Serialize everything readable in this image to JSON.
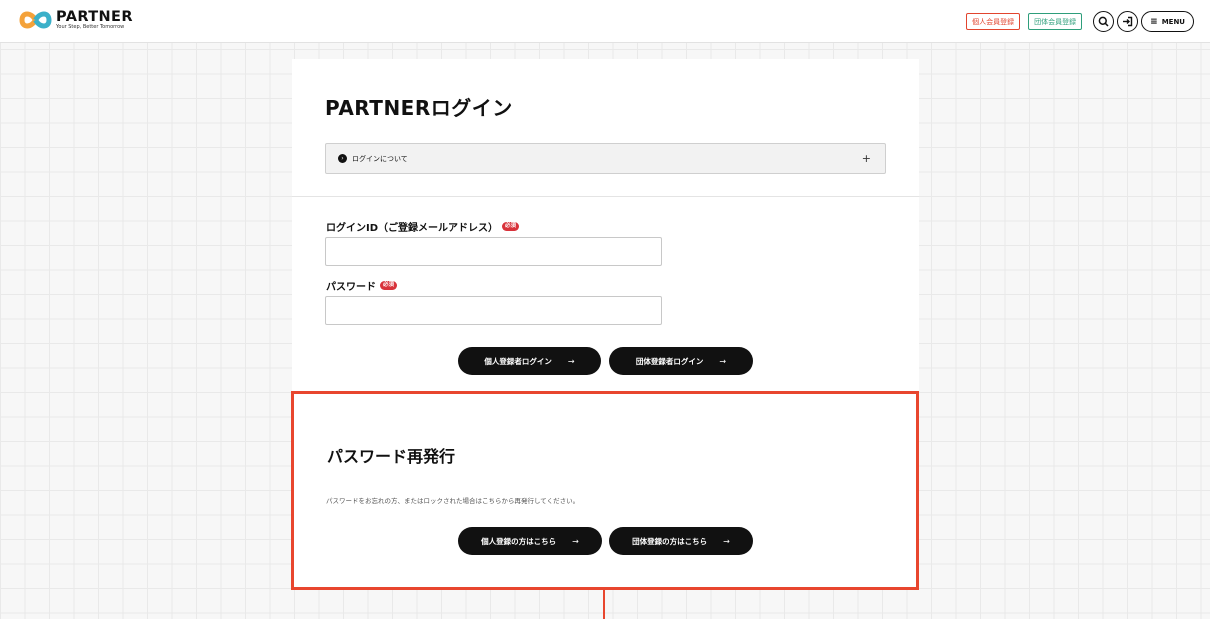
{
  "header": {
    "logo_name": "PARTNER",
    "logo_tagline": "Your Step, Better Tomorrow",
    "register_personal_label": "個人会員登録",
    "register_group_label": "団体会員登録",
    "menu_label": "MENU"
  },
  "login": {
    "title": "PARTNERログイン",
    "about_label": "ログインについて",
    "about_toggle": "+",
    "id_label": "ログインID（ご登録メールアドレス）",
    "password_label": "パスワード",
    "required_badge": "必須",
    "id_value": "",
    "password_value": "",
    "personal_button": "個人登録者ログイン",
    "group_button": "団体登録者ログイン",
    "arrow": "→"
  },
  "reset": {
    "title": "パスワード再発行",
    "description": "パスワードをお忘れの方、またはロックされた場合はこちらから再発行してください。",
    "personal_button": "個人登録の方はこちら",
    "group_button": "団体登録の方はこちら"
  },
  "colors": {
    "accent_highlight": "#e8462e",
    "personal": "#e2452f",
    "group": "#2e9e7b",
    "required": "#d8323a"
  },
  "icons": [
    "partner-logo-icon",
    "search-icon",
    "login-icon",
    "hamburger-icon",
    "info-icon",
    "plus-icon",
    "arrow-right-icon"
  ]
}
